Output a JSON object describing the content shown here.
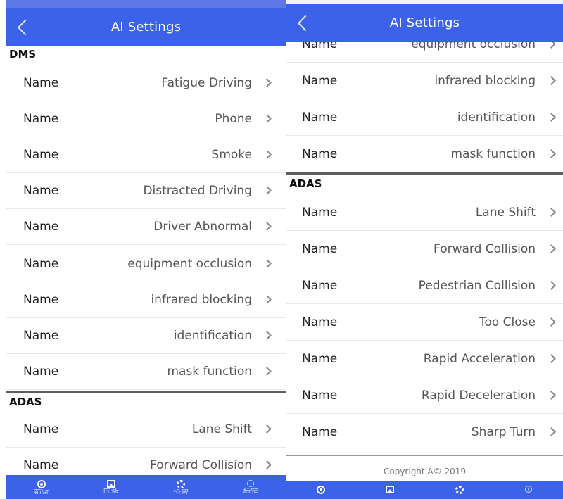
{
  "screen": {
    "title": "AI Settings",
    "row_label": "Name"
  },
  "sections": {
    "dms": "DMS",
    "adas": "ADAS"
  },
  "dms_items": [
    "Fatigue Driving",
    "Phone",
    "Smoke",
    "Distracted Driving",
    "Driver Abnormal",
    "equipment occlusion",
    "infrared blocking",
    "identification",
    "mask function"
  ],
  "adas_items": [
    "Lane Shift",
    "Forward Collision",
    "Pedestrian Collision",
    "Too Close",
    "Rapid Acceleration",
    "Rapid Deceleration",
    "Sharp Turn"
  ],
  "footer": {
    "copyright": "Copyright Â© 2019"
  },
  "tabbar": {
    "accent": "#3b62e8",
    "tabs": [
      {
        "label": "预览",
        "icon": "eye-icon"
      },
      {
        "label": "回放",
        "icon": "image-icon"
      },
      {
        "label": "设置",
        "icon": "gear-icon"
      },
      {
        "label": "标定",
        "icon": "info-icon"
      }
    ]
  }
}
